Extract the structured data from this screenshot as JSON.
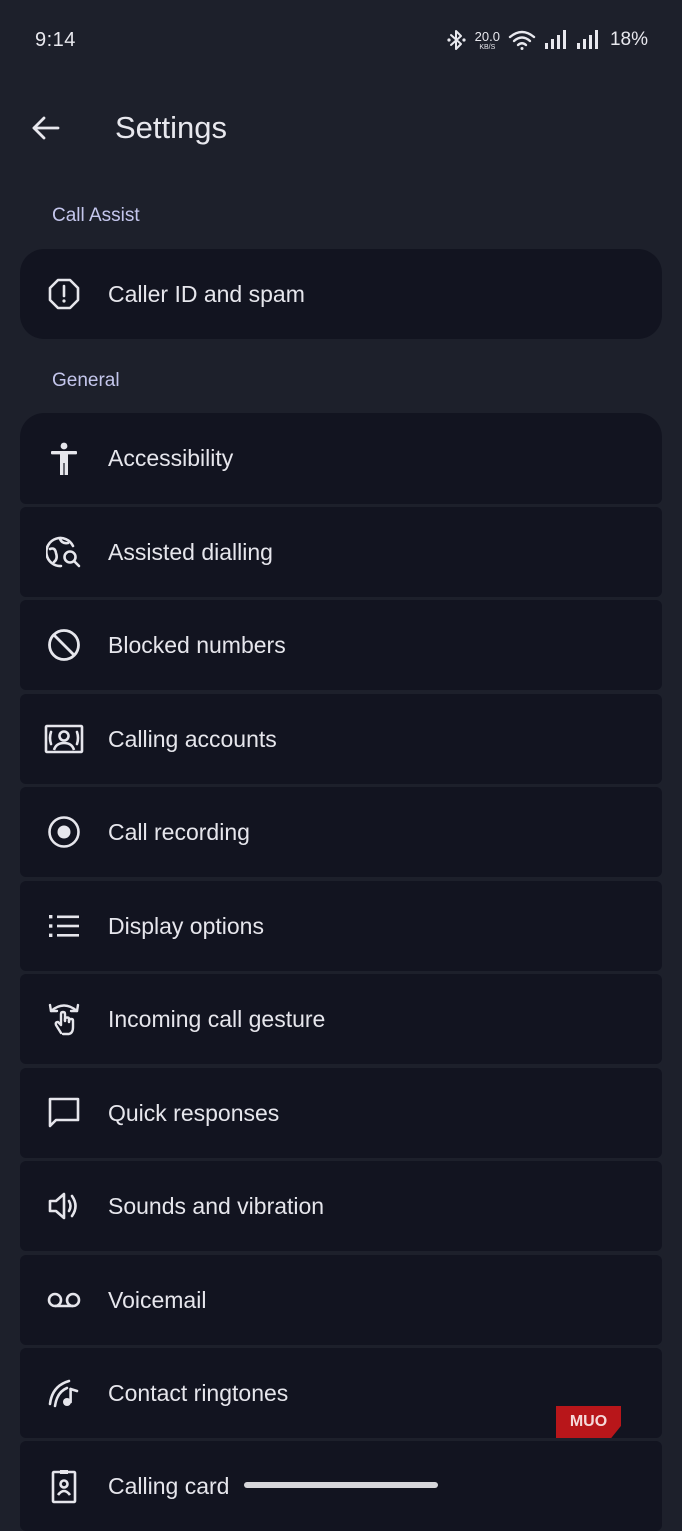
{
  "status_bar": {
    "time": "9:14",
    "net_speed_value": "20.0",
    "net_speed_unit": "KB/S",
    "battery": "18%"
  },
  "app_bar": {
    "title": "Settings",
    "back_icon": "arrow-back-icon"
  },
  "sections": {
    "call_assist": "Call Assist",
    "general": "General"
  },
  "call_assist_items": [
    {
      "label": "Caller ID and spam",
      "icon": "alert-octagon-icon"
    }
  ],
  "general_items": [
    {
      "label": "Accessibility",
      "icon": "accessibility-icon"
    },
    {
      "label": "Assisted dialling",
      "icon": "globe-search-icon"
    },
    {
      "label": "Blocked numbers",
      "icon": "block-icon"
    },
    {
      "label": "Calling accounts",
      "icon": "contact-card-icon"
    },
    {
      "label": "Call recording",
      "icon": "record-icon"
    },
    {
      "label": "Display options",
      "icon": "list-icon"
    },
    {
      "label": "Incoming call gesture",
      "icon": "swipe-gesture-icon"
    },
    {
      "label": "Quick responses",
      "icon": "chat-bubble-icon"
    },
    {
      "label": "Sounds and vibration",
      "icon": "volume-icon"
    },
    {
      "label": "Voicemail",
      "icon": "voicemail-icon"
    },
    {
      "label": "Contact ringtones",
      "icon": "ringtone-icon"
    },
    {
      "label": "Calling card",
      "icon": "badge-icon"
    }
  ],
  "watermark": "MUO",
  "colors": {
    "background": "#1d202b",
    "card": "#121420",
    "section_label": "#c4c6ec",
    "text": "#e6e6ec",
    "watermark": "#b8161a"
  }
}
